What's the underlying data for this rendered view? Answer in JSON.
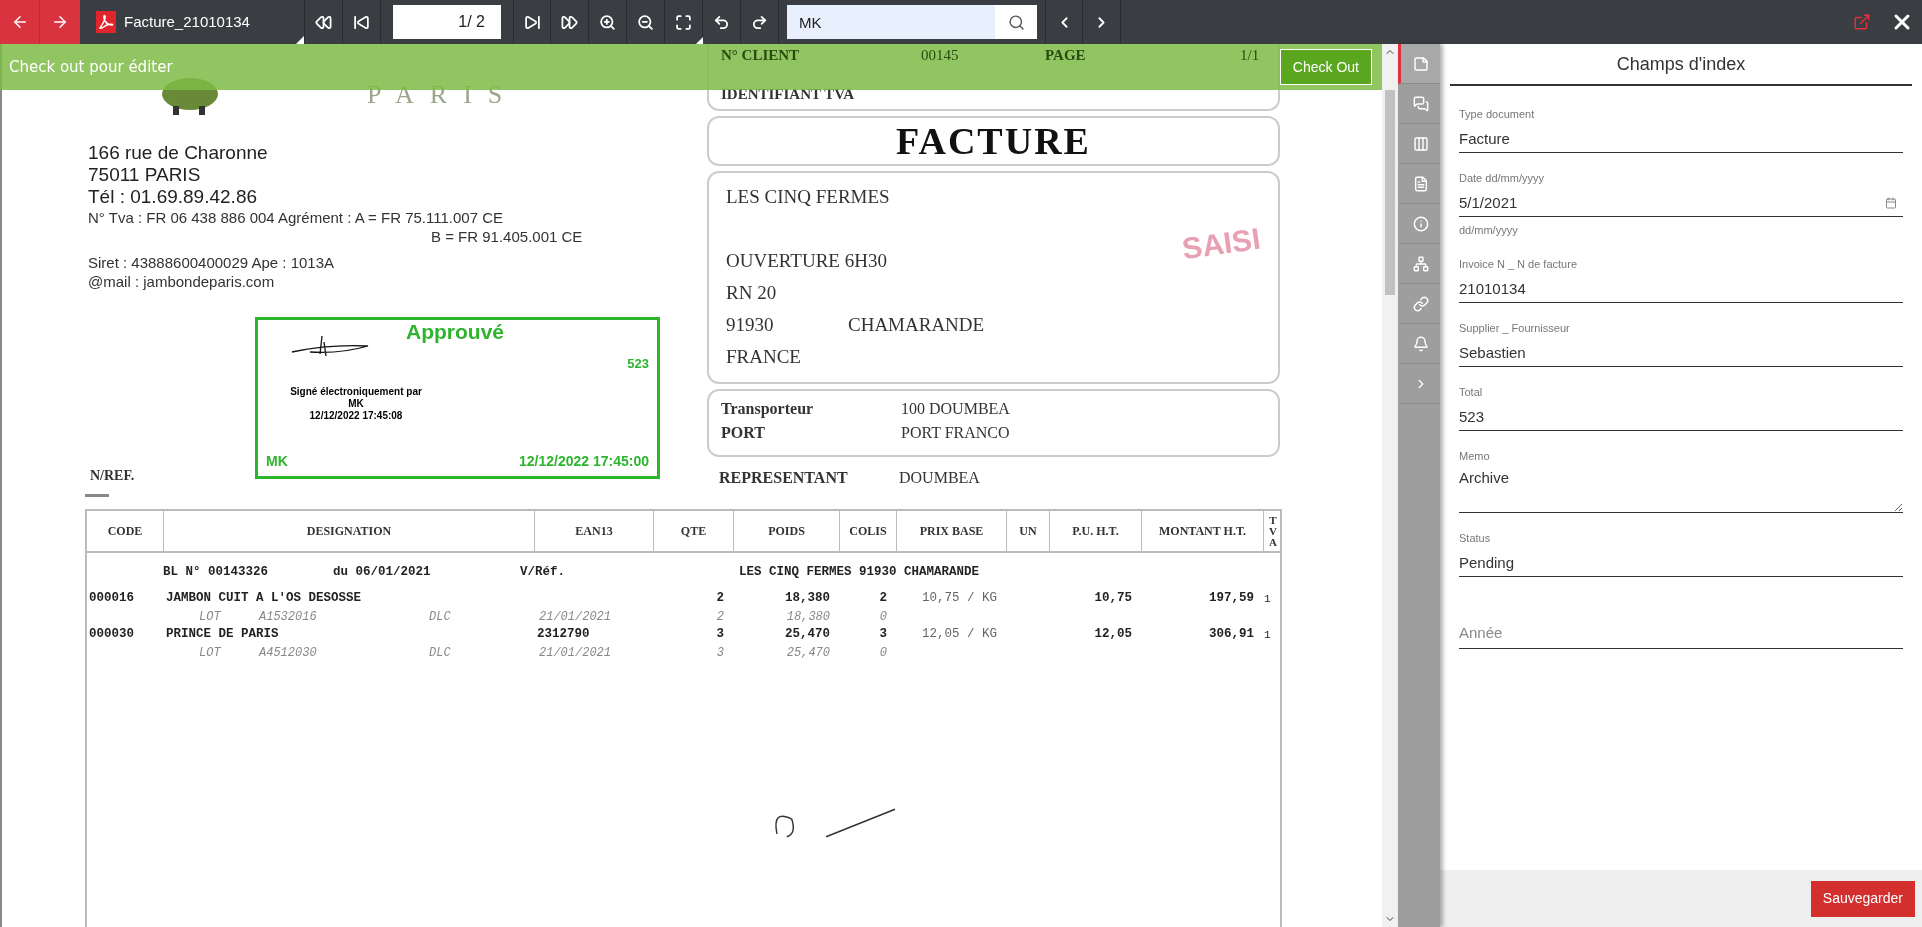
{
  "toolbar": {
    "file_name": "Facture_21010134",
    "page_input": "1/ 2",
    "search": {
      "value": "MK"
    }
  },
  "banner": {
    "message": "Check out pour éditer",
    "button": "Check Out"
  },
  "document": {
    "logo_text": "PARIS",
    "header_box": {
      "client_label": "N° CLIENT",
      "client_value": "00145",
      "page_label": "PAGE",
      "page_value": "1/1",
      "tva_label": "IDENTIFIANT TVA"
    },
    "title": "FACTURE",
    "sender_lines": [
      {
        "text": "166 rue de Charonne",
        "kind": "large"
      },
      {
        "text": "75011  PARIS",
        "kind": "large"
      },
      {
        "text": "Tél : 01.69.89.42.86",
        "kind": "large"
      },
      {
        "text": "N° Tva : FR 06 438 886 004  Agrément :  A = FR 75.111.007  CE",
        "kind": "small"
      },
      {
        "text": "B = FR 91.405.001  CE",
        "kind": "indented"
      },
      {
        "text": "Siret : 43888600400029  Ape : 1013A",
        "kind": "spaced"
      },
      {
        "text": "@mail : jambondeparis.com",
        "kind": "small"
      }
    ],
    "stamp": {
      "title": "Approuvé",
      "amount": "523",
      "signed_text": "Signé électroniquement par",
      "signed_name": "MK",
      "signed_at": "12/12/2022 17:45:08",
      "user": "MK",
      "date": "12/12/2022 17:45:00"
    },
    "nref": "N/REF.",
    "recipient": {
      "lines": [
        "LES CINQ FERMES",
        "OUVERTURE 6H30",
        "RN 20"
      ],
      "postcode": "91930",
      "city": "CHAMARANDE",
      "country": "FRANCE",
      "stamp": "SAISI"
    },
    "transport": [
      {
        "label": "Transporteur",
        "value": "100  DOUMBEA"
      },
      {
        "label": "PORT",
        "value": "PORT FRANCO"
      }
    ],
    "representative": {
      "label": "REPRESENTANT",
      "value": "DOUMBEA"
    },
    "table": {
      "columns": [
        "CODE",
        "DESIGNATION",
        "EAN13",
        "QTE",
        "POIDS",
        "COLIS",
        "PRIX BASE",
        "UN",
        "P.U. H.T.",
        "MONTANT H.T.",
        "TVA"
      ],
      "bl_line": [
        "BL N° 00143326",
        "du 06/01/2021",
        "V/Réf.",
        "LES CINQ FERMES 91930 CHAMARANDE"
      ],
      "rows": [
        {
          "kind": "item",
          "cells": [
            "000016",
            "JAMBON CUIT A L'OS DESOSSE",
            "",
            "2",
            "18,380",
            "2",
            "10,75 / KG",
            "",
            "10,75",
            "197,59",
            "1"
          ]
        },
        {
          "kind": "lot",
          "lot_label": "LOT",
          "lot": "A1532016",
          "dlc_label": "DLC",
          "dlc": "21/01/2021",
          "qte": "2",
          "poids": "18,380",
          "colis": "0"
        },
        {
          "kind": "item",
          "cells": [
            "000030",
            "PRINCE DE PARIS",
            "2312790",
            "3",
            "25,470",
            "3",
            "12,05 / KG",
            "",
            "12,05",
            "306,91",
            "1"
          ]
        },
        {
          "kind": "lot",
          "lot_label": "LOT",
          "lot": "A4512030",
          "dlc_label": "DLC",
          "dlc": "21/01/2021",
          "qte": "3",
          "poids": "25,470",
          "colis": "0"
        }
      ]
    }
  },
  "rail": [
    {
      "selected": true
    },
    {
      "selected": false
    },
    {
      "selected": false
    },
    {
      "selected": false
    },
    {
      "selected": false
    },
    {
      "selected": false
    },
    {
      "selected": false
    },
    {
      "selected": false
    },
    {
      "selected": false
    }
  ],
  "panel": {
    "title": "Champs d'index",
    "fields": [
      {
        "kind": "text",
        "label": "Type document",
        "value": "Facture"
      },
      {
        "kind": "date",
        "label": "Date dd/mm/yyyy",
        "value": "5/1/2021",
        "hint": "dd/mm/yyyy"
      },
      {
        "kind": "text",
        "label": "Invoice N _ N de facture",
        "value": "21010134"
      },
      {
        "kind": "text",
        "label": "Supplier _ Fournisseur",
        "value": "Sebastien"
      },
      {
        "kind": "text",
        "label": "Total",
        "value": "523"
      },
      {
        "kind": "textarea",
        "label": "Memo",
        "value": "Archive"
      },
      {
        "kind": "text",
        "label": "Status",
        "value": "Pending"
      },
      {
        "kind": "empty",
        "placeholder": "Année"
      }
    ],
    "save_button": "Sauvegarder"
  }
}
